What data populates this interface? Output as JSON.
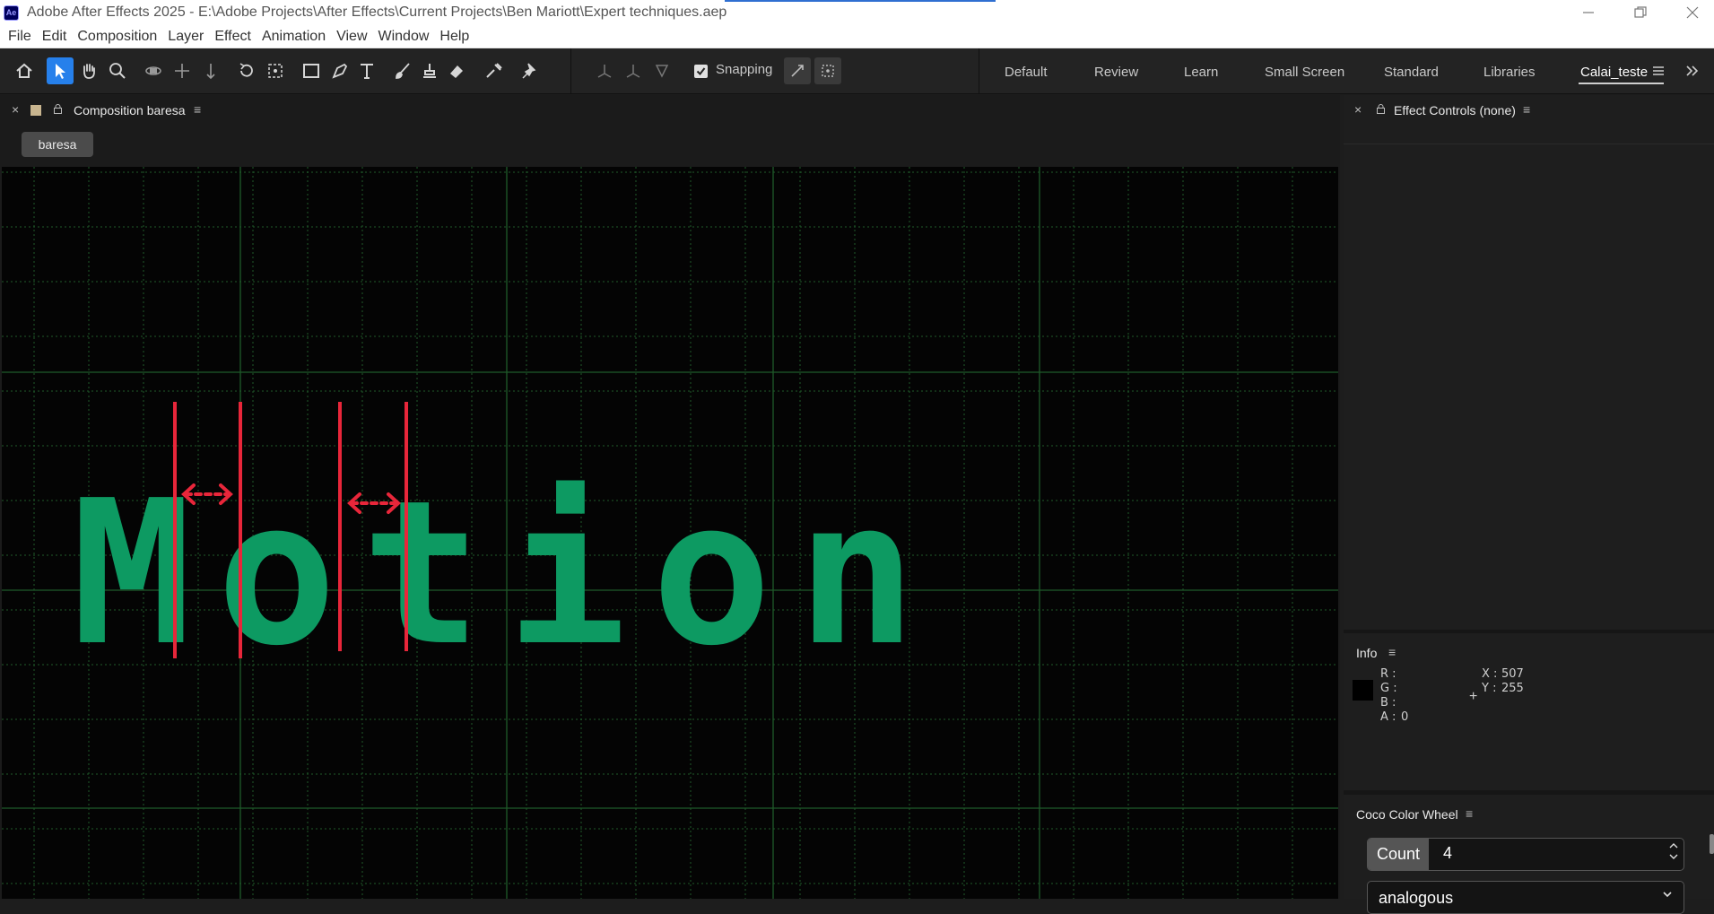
{
  "window": {
    "title": "Adobe After Effects 2025 - E:\\Adobe Projects\\After Effects\\Current Projects\\Ben Mariott\\Expert techniques.aep",
    "app_icon_label": "Ae"
  },
  "menu": [
    "File",
    "Edit",
    "Composition",
    "Layer",
    "Effect",
    "Animation",
    "View",
    "Window",
    "Help"
  ],
  "toolbar": {
    "tools": [
      "home-icon",
      "selection-icon",
      "hand-icon",
      "zoom-icon",
      "orbit-camera-icon",
      "pan-camera-icon",
      "dolly-camera-icon",
      "rotation-icon",
      "pan-behind-icon",
      "rectangle-icon",
      "pen-icon",
      "type-icon",
      "brush-icon",
      "clone-stamp-icon",
      "eraser-icon",
      "roto-brush-icon",
      "puppet-pin-icon"
    ],
    "snapping_label": "Snapping",
    "snapping_checked": true
  },
  "workspaces": {
    "items": [
      "Default",
      "Review",
      "Learn",
      "Small Screen",
      "Standard",
      "Libraries",
      "Calai_teste"
    ],
    "active": "Calai_teste"
  },
  "composition_panel": {
    "title": "Composition baresa",
    "tab": "baresa",
    "viewer_text": "Motion",
    "text_color": "#0d9a62",
    "guide_color": "#e8263a",
    "grid_color": "#1f5a2a"
  },
  "effect_controls": {
    "title": "Effect Controls (none)"
  },
  "info": {
    "title": "Info",
    "r_label": "R :",
    "g_label": "G :",
    "b_label": "B :",
    "a_label": "A :",
    "a_value": "0",
    "x_label": "X :",
    "x_value": "507",
    "y_label": "Y :",
    "y_value": "255"
  },
  "coco_color_wheel": {
    "title": "Coco Color Wheel",
    "count_label": "Count",
    "count_value": "4",
    "scheme_value": "analogous"
  }
}
